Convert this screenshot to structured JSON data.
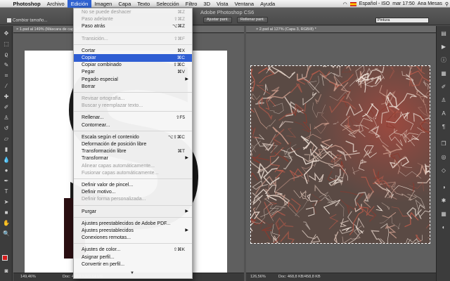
{
  "menubar": {
    "apple": "",
    "items": [
      "Photoshop",
      "Archivo",
      "Edición",
      "Imagen",
      "Capa",
      "Texto",
      "Selección",
      "Filtro",
      "3D",
      "Vista",
      "Ventana",
      "Ayuda"
    ],
    "active": "Edición",
    "status": {
      "language": "Español - ISO",
      "clock": "mar 17:50",
      "user": "Ana Mesas"
    }
  },
  "app_title": "Adobe Photoshop CS6",
  "options_bar": {
    "checkbox_label": "Cambiar tamaño...",
    "buttons": [
      "Ajustar pant.",
      "Rellenar pant."
    ],
    "workspace": "Pintura"
  },
  "document1": {
    "tab": "1.psd al 149% (Máscara de capa/8)",
    "zoom": "149,46%",
    "doc_info": "Doc: 458,8 KB/3,54 MB"
  },
  "document2": {
    "tab": "2.psd al 127% (Capa 3, RGB/8) *",
    "zoom": "126,56%",
    "doc_info": "Doc: 468,8 KB/458,8 KB"
  },
  "edit_menu": {
    "items": [
      {
        "label": "No se puede deshacer",
        "shortcut": "⌘Z",
        "disabled": true
      },
      {
        "label": "Paso adelante",
        "shortcut": "⇧⌘Z",
        "disabled": true
      },
      {
        "label": "Paso atrás",
        "shortcut": "⌥⌘Z",
        "disabled": false
      },
      {
        "sep": true
      },
      {
        "label": "Transición...",
        "shortcut": "⇧⌘F",
        "disabled": true
      },
      {
        "sep": true
      },
      {
        "label": "Cortar",
        "shortcut": "⌘X",
        "disabled": false
      },
      {
        "label": "Copiar",
        "shortcut": "⌘C",
        "disabled": false,
        "highlight": true
      },
      {
        "label": "Copiar combinado",
        "shortcut": "⇧⌘C",
        "disabled": false
      },
      {
        "label": "Pegar",
        "shortcut": "⌘V",
        "disabled": false
      },
      {
        "label": "Pegado especial",
        "submenu": true,
        "disabled": false
      },
      {
        "label": "Borrar",
        "disabled": false
      },
      {
        "sep": true
      },
      {
        "label": "Revisar ortografía...",
        "disabled": true
      },
      {
        "label": "Buscar y reemplazar texto...",
        "disabled": true
      },
      {
        "sep": true
      },
      {
        "label": "Rellenar...",
        "shortcut": "⇧F5",
        "disabled": false
      },
      {
        "label": "Contornear...",
        "disabled": false
      },
      {
        "sep": true
      },
      {
        "label": "Escala según el contenido",
        "shortcut": "⌥⇧⌘C",
        "disabled": false
      },
      {
        "label": "Deformación de posición libre",
        "disabled": false
      },
      {
        "label": "Transformación libre",
        "shortcut": "⌘T",
        "disabled": false
      },
      {
        "label": "Transformar",
        "submenu": true,
        "disabled": false
      },
      {
        "label": "Alinear capas automáticamente...",
        "disabled": true
      },
      {
        "label": "Fusionar capas automáticamente...",
        "disabled": true
      },
      {
        "sep": true
      },
      {
        "label": "Definir valor de pincel...",
        "disabled": false
      },
      {
        "label": "Definir motivo...",
        "disabled": false
      },
      {
        "label": "Definir forma personalizada...",
        "disabled": true
      },
      {
        "sep": true
      },
      {
        "label": "Purgar",
        "submenu": true,
        "disabled": false
      },
      {
        "sep": true
      },
      {
        "label": "Ajustes preestablecidos de Adobe PDF...",
        "disabled": false
      },
      {
        "label": "Ajustes preestablecidos",
        "submenu": true,
        "disabled": false
      },
      {
        "label": "Conexiones remotas...",
        "disabled": false
      },
      {
        "sep": true
      },
      {
        "label": "Ajustes de color...",
        "shortcut": "⇧⌘K",
        "disabled": false
      },
      {
        "label": "Asignar perfil...",
        "disabled": false
      },
      {
        "label": "Convertir en perfil...",
        "disabled": false
      }
    ],
    "more_indicator": "▼"
  },
  "icons": {
    "tools": [
      "move-icon",
      "marquee-icon",
      "lasso-icon",
      "quick-select-icon",
      "crop-icon",
      "eyedropper-icon",
      "healing-brush-icon",
      "brush-icon",
      "clone-stamp-icon",
      "history-brush-icon",
      "eraser-icon",
      "gradient-icon",
      "blur-icon",
      "dodge-icon",
      "pen-icon",
      "type-icon",
      "path-select-icon",
      "shape-icon",
      "hand-icon",
      "zoom-icon"
    ],
    "dock": [
      "history-panel-icon",
      "actions-panel-icon",
      "info-panel-icon",
      "properties-icon",
      "brush-panel-icon",
      "clone-source-icon",
      "character-panel-icon",
      "paragraph-panel-icon",
      "layers-panel-icon",
      "channels-panel-icon",
      "paths-panel-icon",
      "adjustments-panel-icon",
      "styles-panel-icon",
      "swatches-panel-icon",
      "color-panel-icon"
    ]
  },
  "colors": {
    "foreground": "#d51a1a",
    "background": "#ffffff",
    "menu_highlight": "#2f5ed3"
  }
}
